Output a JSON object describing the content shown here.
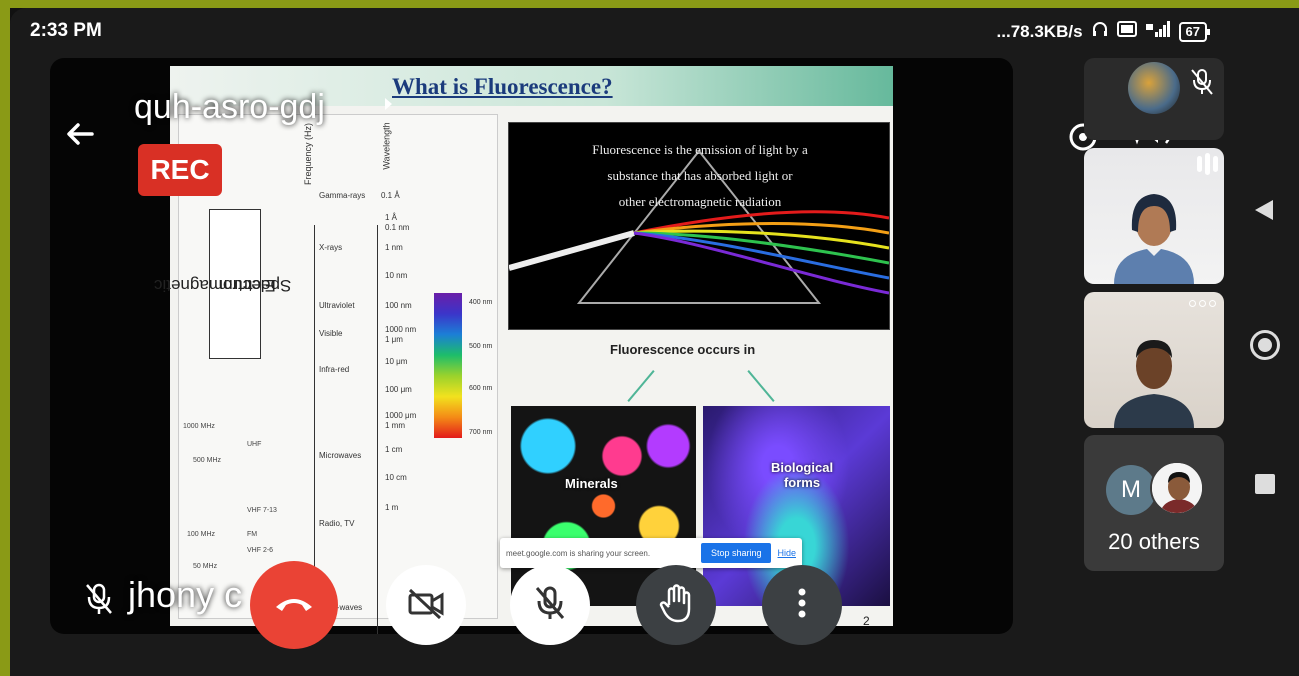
{
  "status_bar": {
    "time": "2:33 PM",
    "network_speed": "...78.3KB/s",
    "icons": [
      "headphones-icon",
      "volte-icon",
      "4g-signal-icon"
    ],
    "battery": "67"
  },
  "meeting": {
    "code": "quh-asro-gdj",
    "recording_badge": "REC",
    "presenter_name": "jhony c"
  },
  "slide": {
    "title": "What is Fluorescence?",
    "spectrum_label_line1": "Electromagnetic",
    "spectrum_label_line2": "Spectrum",
    "frequency_header": "Frequency (Hz)",
    "wavelength_header": "Wavelength",
    "bands": [
      "Gamma-rays",
      "X-rays",
      "Ultraviolet",
      "Visible",
      "Infra-red",
      "Microwaves",
      "Radio, TV",
      "Long-waves"
    ],
    "wavelengths": [
      "0.1 Å",
      "1 Å",
      "0.1 nm",
      "1 nm",
      "10 nm",
      "100 nm",
      "1000 nm",
      "1 μm",
      "10 μm",
      "100 μm",
      "1000 μm",
      "1 mm",
      "1 cm",
      "10 cm",
      "1 m"
    ],
    "radio_freqs": [
      "1000 MHz",
      "500 MHz",
      "100 MHz",
      "50 MHz"
    ],
    "radio_labels": [
      "UHF",
      "VHF 7-13",
      "FM",
      "VHF 2-6"
    ],
    "nm_marks": [
      "400 nm",
      "500 nm",
      "600 nm",
      "700 nm"
    ],
    "definition_line1": "Fluorescence is the emission of light by a",
    "definition_line2": "substance that has absorbed light or",
    "definition_line3": "other electromagnetic radiation",
    "occurs_in": "Fluorescence occurs in",
    "minerals_label": "Minerals",
    "biological_label": "Biological forms",
    "page_number": "2"
  },
  "share_bar": {
    "message": "meet.google.com is sharing your screen.",
    "stop_label": "Stop sharing",
    "hide_label": "Hide"
  },
  "controls": {
    "icons": [
      "end-call-icon",
      "camera-off-icon",
      "mic-off-icon",
      "raise-hand-icon",
      "more-options-icon"
    ]
  },
  "participants": {
    "others_initial": "M",
    "others_label": "20 others"
  },
  "colors": {
    "record_red": "#d93025",
    "end_call_red": "#ea4335",
    "google_blue": "#1a73e8"
  }
}
